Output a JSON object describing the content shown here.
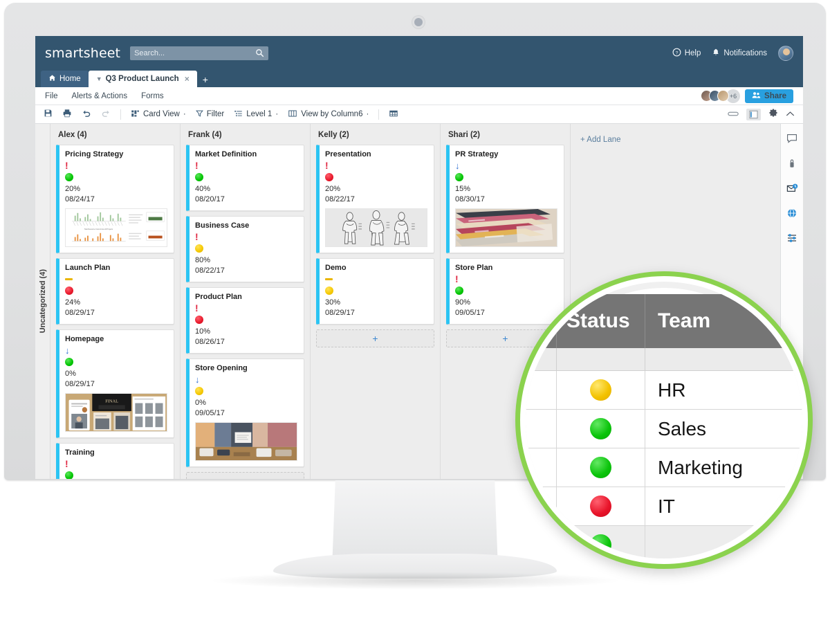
{
  "app": {
    "logo": "smartsheet",
    "search_placeholder": "Search...",
    "help_label": "Help",
    "notifications_label": "Notifications"
  },
  "tabs": [
    {
      "label": "Home",
      "icon": "home-icon",
      "active": false
    },
    {
      "label": "Q3 Product Launch",
      "close": "×",
      "active": true
    }
  ],
  "tab_add_label": "+",
  "menubar": {
    "items": [
      "File",
      "Alerts & Actions",
      "Forms"
    ],
    "facepile_more": "+6",
    "share_label": "Share"
  },
  "toolbar": {
    "save_icon": "save-icon",
    "print_icon": "print-icon",
    "undo_icon": "undo-icon",
    "redo_icon": "redo-icon",
    "card_view_label": "Card View",
    "filter_label": "Filter",
    "level_label": "Level 1",
    "view_by_label": "View by Column6",
    "grid_icon": "grid-icon",
    "caret": "·",
    "right_icons": [
      "minimize-icon",
      "panel-icon",
      "gear-icon",
      "chevron-up-icon"
    ]
  },
  "board": {
    "lane_label": "Uncategorized (4)",
    "add_lane_label": "+ Add Lane",
    "add_card_label": "+",
    "columns": [
      {
        "title": "Alex (4)",
        "cards": [
          {
            "title": "Pricing Strategy",
            "flag": "bang",
            "status": "green",
            "percent": "20%",
            "date": "08/24/17",
            "thumb": "dashboard-charts"
          },
          {
            "title": "Launch Plan",
            "flag": "dash",
            "status": "red",
            "percent": "24%",
            "date": "08/29/17",
            "thumb": ""
          },
          {
            "title": "Homepage",
            "flag": "arrow",
            "status": "green",
            "percent": "0%",
            "date": "08/29/17",
            "thumb": "webpage-mockups"
          },
          {
            "title": "Training",
            "flag": "bang",
            "status": "green",
            "percent": "",
            "date": "",
            "thumb": ""
          }
        ]
      },
      {
        "title": "Frank (4)",
        "cards": [
          {
            "title": "Market Definition",
            "flag": "bang",
            "status": "green",
            "percent": "40%",
            "date": "08/20/17",
            "thumb": ""
          },
          {
            "title": "Business Case",
            "flag": "bang",
            "status": "yellow",
            "percent": "80%",
            "date": "08/22/17",
            "thumb": ""
          },
          {
            "title": "Product Plan",
            "flag": "bang",
            "status": "red",
            "percent": "10%",
            "date": "08/26/17",
            "thumb": ""
          },
          {
            "title": "Store Opening",
            "flag": "arrow",
            "status": "yellow",
            "percent": "0%",
            "date": "09/05/17",
            "thumb": "store-photo"
          }
        ]
      },
      {
        "title": "Kelly (2)",
        "cards": [
          {
            "title": "Presentation",
            "flag": "bang",
            "status": "red",
            "percent": "20%",
            "date": "08/22/17",
            "thumb": "fashion-sketch"
          },
          {
            "title": "Demo",
            "flag": "dash",
            "status": "yellow",
            "percent": "30%",
            "date": "08/29/17",
            "thumb": ""
          }
        ]
      },
      {
        "title": "Shari (2)",
        "cards": [
          {
            "title": "PR Strategy",
            "flag": "arrow",
            "status": "green",
            "percent": "15%",
            "date": "08/30/17",
            "thumb": "magazines-photo"
          },
          {
            "title": "Store Plan",
            "flag": "bang",
            "status": "green",
            "percent": "90%",
            "date": "09/05/17",
            "thumb": ""
          }
        ]
      }
    ]
  },
  "rail_icons": [
    "comment-icon",
    "attachment-icon",
    "reminder-icon",
    "publish-icon",
    "settings-sliders-icon"
  ],
  "magnifier": {
    "headers": [
      "",
      "Status",
      "Team"
    ],
    "rows": [
      {
        "flag": "",
        "status": "yellow",
        "team": "HR"
      },
      {
        "flag": "bang",
        "status": "green",
        "team": "Sales"
      },
      {
        "flag": "",
        "status": "green",
        "team": "Marketing"
      },
      {
        "flag": "",
        "status": "red",
        "team": "IT"
      }
    ]
  },
  "colors": {
    "brand_navy": "#33556f",
    "accent_blue": "#29a0e0",
    "card_stripe": "#2bc4f3",
    "magnifier_ring": "#8bd24e",
    "status_green": "#00c400",
    "status_yellow": "#f5c800",
    "status_red": "#e8192b"
  }
}
